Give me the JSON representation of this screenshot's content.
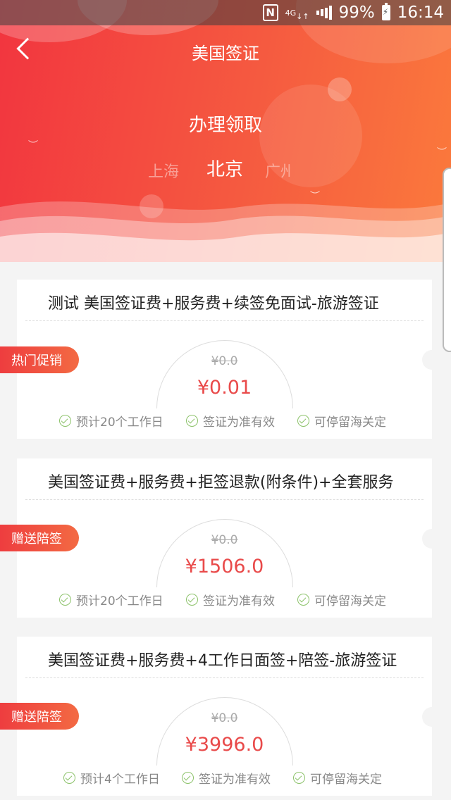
{
  "status_bar": {
    "nfc": "N",
    "network": "4G",
    "battery": "99%",
    "time": "16:14"
  },
  "nav": {
    "title": "美国签证"
  },
  "service": {
    "label": "办理领取"
  },
  "cities": {
    "left": "上海",
    "selected": "北京",
    "right": "广州"
  },
  "products": [
    {
      "title": "测试 美国签证费+服务费+续签免面试-旅游签证",
      "tag": "热门促销",
      "original_price": "¥0.0",
      "price": "¥0.01",
      "features": [
        "预计20个工作日",
        "签证为准有效",
        "可停留海关定"
      ]
    },
    {
      "title": "美国签证费+服务费+拒签退款(附条件)+全套服务",
      "tag": "赠送陪签",
      "original_price": "¥0.0",
      "price": "¥1506.0",
      "features": [
        "预计20个工作日",
        "签证为准有效",
        "可停留海关定"
      ]
    },
    {
      "title": "美国签证费+服务费+4工作日面签+陪签-旅游签证",
      "tag": "赠送陪签",
      "original_price": "¥0.0",
      "price": "¥3996.0",
      "features": [
        "预计4个工作日",
        "签证为准有效",
        "可停留海关定"
      ]
    }
  ],
  "colors": {
    "header_start": "#f2353f",
    "header_end": "#fb7a3c",
    "price": "#e94a4a",
    "check": "#8cc26a"
  }
}
